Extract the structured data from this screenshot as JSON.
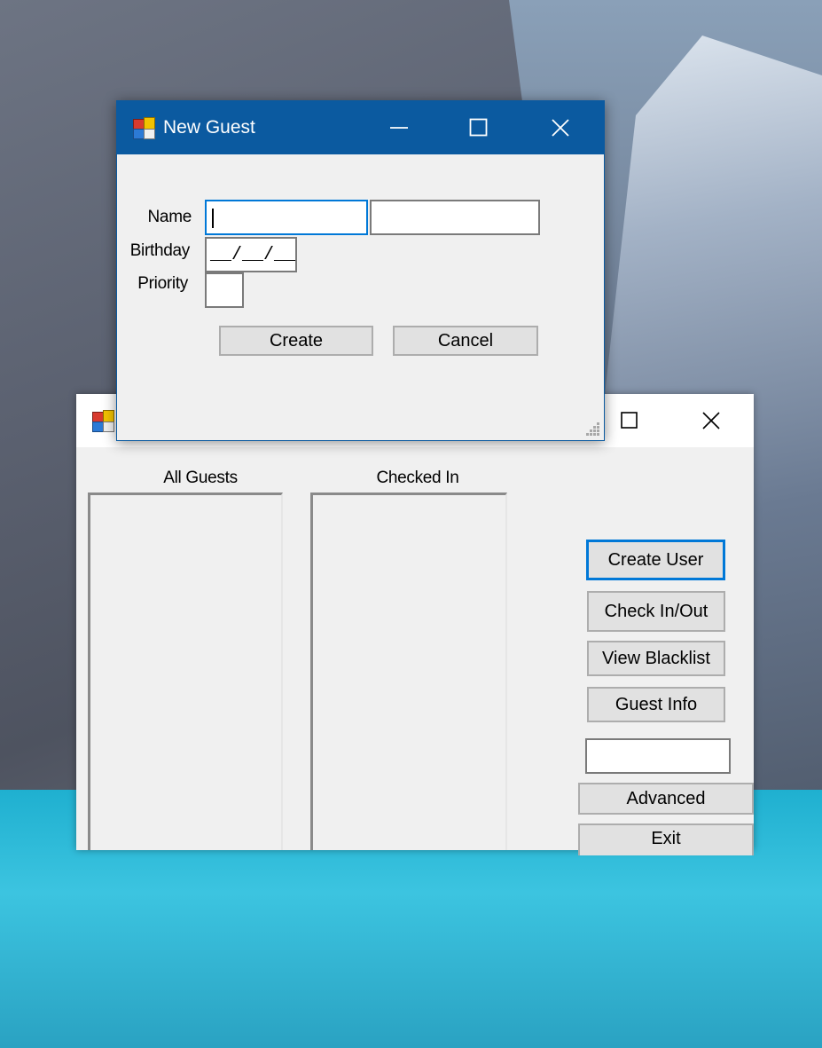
{
  "main_window": {
    "title": "",
    "labels": {
      "all_guests": "All Guests",
      "checked_in": "Checked In"
    },
    "buttons": {
      "create_user": "Create User",
      "check_in_out": "Check In/Out",
      "view_blacklist": "View Blacklist",
      "guest_info": "Guest Info",
      "advanced": "Advanced",
      "exit": "Exit"
    },
    "text_input_value": ""
  },
  "new_guest_dialog": {
    "title": "New Guest",
    "labels": {
      "name": "Name",
      "birthday": "Birthday",
      "priority": "Priority"
    },
    "first_name_value": "",
    "last_name_value": "",
    "birthday_mask": "__/__/__",
    "priority_value": "",
    "buttons": {
      "create": "Create",
      "cancel": "Cancel"
    }
  },
  "colors": {
    "dialog_titlebar": "#0b5aa0",
    "focus_border": "#0078d7",
    "window_bg": "#f0f0f0",
    "button_bg": "#e1e1e1"
  },
  "icons": {
    "app": "app-form-icon",
    "minimize": "minimize-icon",
    "maximize": "maximize-icon",
    "close": "close-icon"
  }
}
